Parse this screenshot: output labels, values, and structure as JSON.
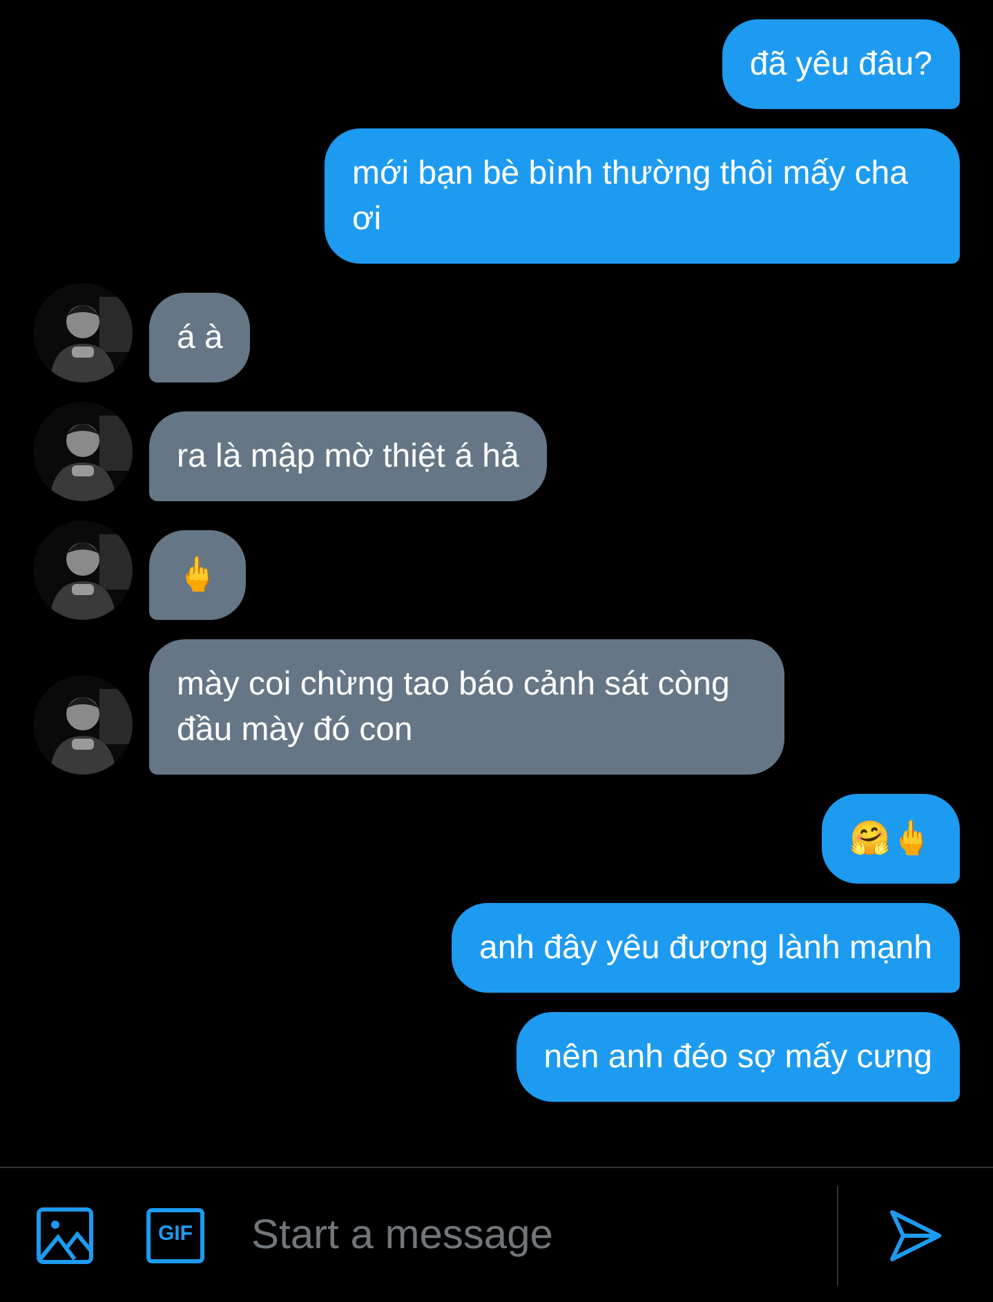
{
  "messages": [
    {
      "kind": "sent",
      "text": "đã yêu đâu?"
    },
    {
      "kind": "sent",
      "text": "mới bạn bè bình thường thôi mấy cha ơi"
    },
    {
      "kind": "received",
      "text": "á à"
    },
    {
      "kind": "received",
      "text": "ra là mập mờ thiệt á hả"
    },
    {
      "kind": "received",
      "text": "🖕"
    },
    {
      "kind": "received",
      "text": "mày coi chừng tao báo cảnh sát còng đầu mày đó con"
    },
    {
      "kind": "sent",
      "text": "🤗🖕"
    },
    {
      "kind": "sent",
      "text": "anh đây yêu đương lành mạnh"
    },
    {
      "kind": "sent",
      "text": "nên anh đéo sợ mấy cưng"
    }
  ],
  "composer": {
    "placeholder": "Start a message",
    "gif_label": "GIF"
  }
}
